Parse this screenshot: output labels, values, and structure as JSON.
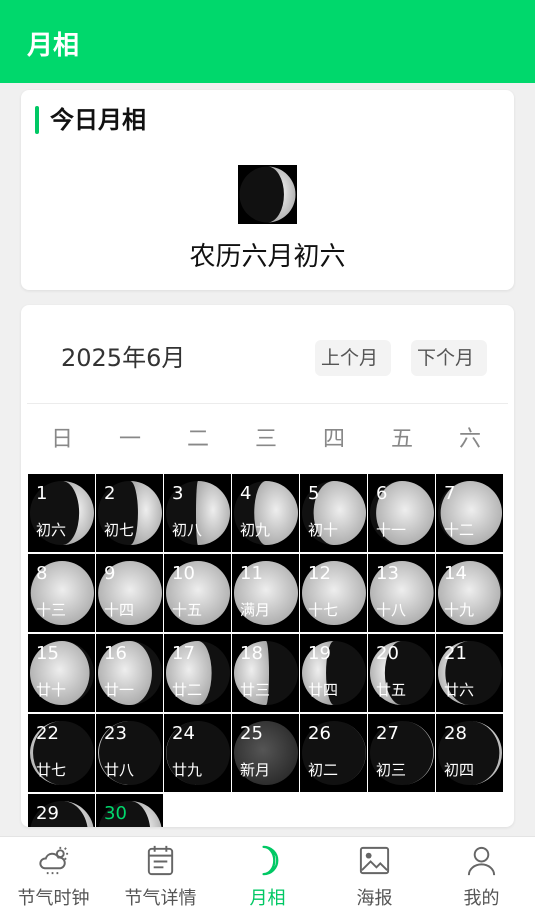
{
  "header": {
    "title": "月相"
  },
  "today": {
    "heading": "今日月相",
    "lunar_date": "农历六月初六",
    "illumination": 0.3,
    "waxing": true
  },
  "calendar": {
    "year_month": "2025年6月",
    "prev_label": "上个月",
    "next_label": "下个月",
    "weekdays": [
      "日",
      "一",
      "二",
      "三",
      "四",
      "五",
      "六"
    ],
    "today_day": "30",
    "days": [
      {
        "day": "1",
        "lunar": "初六",
        "illum": 0.32,
        "waxing": true
      },
      {
        "day": "2",
        "lunar": "初七",
        "illum": 0.42,
        "waxing": true
      },
      {
        "day": "3",
        "lunar": "初八",
        "illum": 0.52,
        "waxing": true
      },
      {
        "day": "4",
        "lunar": "初九",
        "illum": 0.62,
        "waxing": true
      },
      {
        "day": "5",
        "lunar": "初十",
        "illum": 0.72,
        "waxing": true
      },
      {
        "day": "6",
        "lunar": "十一",
        "illum": 0.8,
        "waxing": true
      },
      {
        "day": "7",
        "lunar": "十二",
        "illum": 0.87,
        "waxing": true
      },
      {
        "day": "8",
        "lunar": "十三",
        "illum": 0.93,
        "waxing": true
      },
      {
        "day": "9",
        "lunar": "十四",
        "illum": 0.97,
        "waxing": true
      },
      {
        "day": "10",
        "lunar": "十五",
        "illum": 0.99,
        "waxing": true
      },
      {
        "day": "11",
        "lunar": "满月",
        "illum": 1.0,
        "waxing": true
      },
      {
        "day": "12",
        "lunar": "十七",
        "illum": 0.98,
        "waxing": false
      },
      {
        "day": "13",
        "lunar": "十八",
        "illum": 0.95,
        "waxing": false
      },
      {
        "day": "14",
        "lunar": "十九",
        "illum": 0.9,
        "waxing": false
      },
      {
        "day": "15",
        "lunar": "廿十",
        "illum": 0.83,
        "waxing": false
      },
      {
        "day": "16",
        "lunar": "廿一",
        "illum": 0.74,
        "waxing": false
      },
      {
        "day": "17",
        "lunar": "廿二",
        "illum": 0.64,
        "waxing": false
      },
      {
        "day": "18",
        "lunar": "廿三",
        "illum": 0.53,
        "waxing": false
      },
      {
        "day": "19",
        "lunar": "廿四",
        "illum": 0.42,
        "waxing": false
      },
      {
        "day": "20",
        "lunar": "廿五",
        "illum": 0.32,
        "waxing": false
      },
      {
        "day": "21",
        "lunar": "廿六",
        "illum": 0.22,
        "waxing": false
      },
      {
        "day": "22",
        "lunar": "廿七",
        "illum": 0.14,
        "waxing": false
      },
      {
        "day": "23",
        "lunar": "廿八",
        "illum": 0.08,
        "waxing": false
      },
      {
        "day": "24",
        "lunar": "廿九",
        "illum": 0.04,
        "waxing": false
      },
      {
        "day": "25",
        "lunar": "新月",
        "illum": 0.0,
        "waxing": true
      },
      {
        "day": "26",
        "lunar": "初二",
        "illum": 0.03,
        "waxing": true
      },
      {
        "day": "27",
        "lunar": "初三",
        "illum": 0.07,
        "waxing": true
      },
      {
        "day": "28",
        "lunar": "初四",
        "illum": 0.13,
        "waxing": true
      },
      {
        "day": "29",
        "lunar": "",
        "illum": 0.2,
        "waxing": true
      },
      {
        "day": "30",
        "lunar": "",
        "illum": 0.28,
        "waxing": true
      }
    ]
  },
  "tabs": [
    {
      "label": "节气时钟",
      "icon": "cloud-sun-icon",
      "active": false
    },
    {
      "label": "节气详情",
      "icon": "calendar-icon",
      "active": false
    },
    {
      "label": "月相",
      "icon": "crescent-moon-icon",
      "active": true
    },
    {
      "label": "海报",
      "icon": "image-icon",
      "active": false
    },
    {
      "label": "我的",
      "icon": "user-icon",
      "active": false
    }
  ],
  "colors": {
    "brand": "#00d86c",
    "active_tab": "#00c864",
    "today": "#00d86c"
  }
}
